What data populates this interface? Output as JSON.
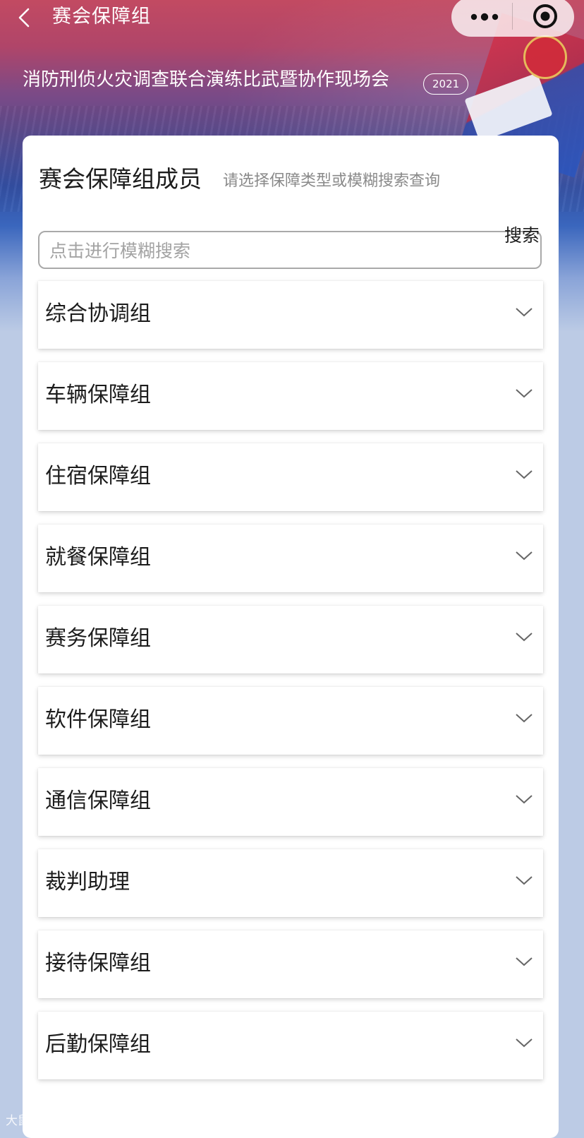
{
  "nav": {
    "title": "赛会保障组"
  },
  "header": {
    "event_title": "消防刑侦火灾调查联合演练比武暨协作现场会",
    "year_badge": "2021"
  },
  "card": {
    "title": "赛会保障组成员",
    "hint": "请选择保障类型或模糊搜索查询"
  },
  "search": {
    "placeholder": "点击进行模糊搜索",
    "value": "",
    "button_label": "搜索"
  },
  "groups": [
    {
      "label": "综合协调组"
    },
    {
      "label": "车辆保障组"
    },
    {
      "label": "住宿保障组"
    },
    {
      "label": "就餐保障组"
    },
    {
      "label": "赛务保障组"
    },
    {
      "label": "软件保障组"
    },
    {
      "label": "通信保障组"
    },
    {
      "label": "裁判助理"
    },
    {
      "label": "接待保障组"
    },
    {
      "label": "后勤保障组"
    }
  ],
  "watermark": "大鼠跨镜",
  "icons": {
    "back": "chevron-left-icon",
    "more": "more-dots-icon",
    "close": "target-circle-icon",
    "expand": "chevron-down-icon"
  },
  "colors": {
    "header_top": "#c24a62",
    "header_bottom": "#344fa3",
    "page_bg": "#bccbe5",
    "card_bg": "#ffffff",
    "text_primary": "#1c1c1c",
    "text_hint": "#8a8a8a"
  }
}
